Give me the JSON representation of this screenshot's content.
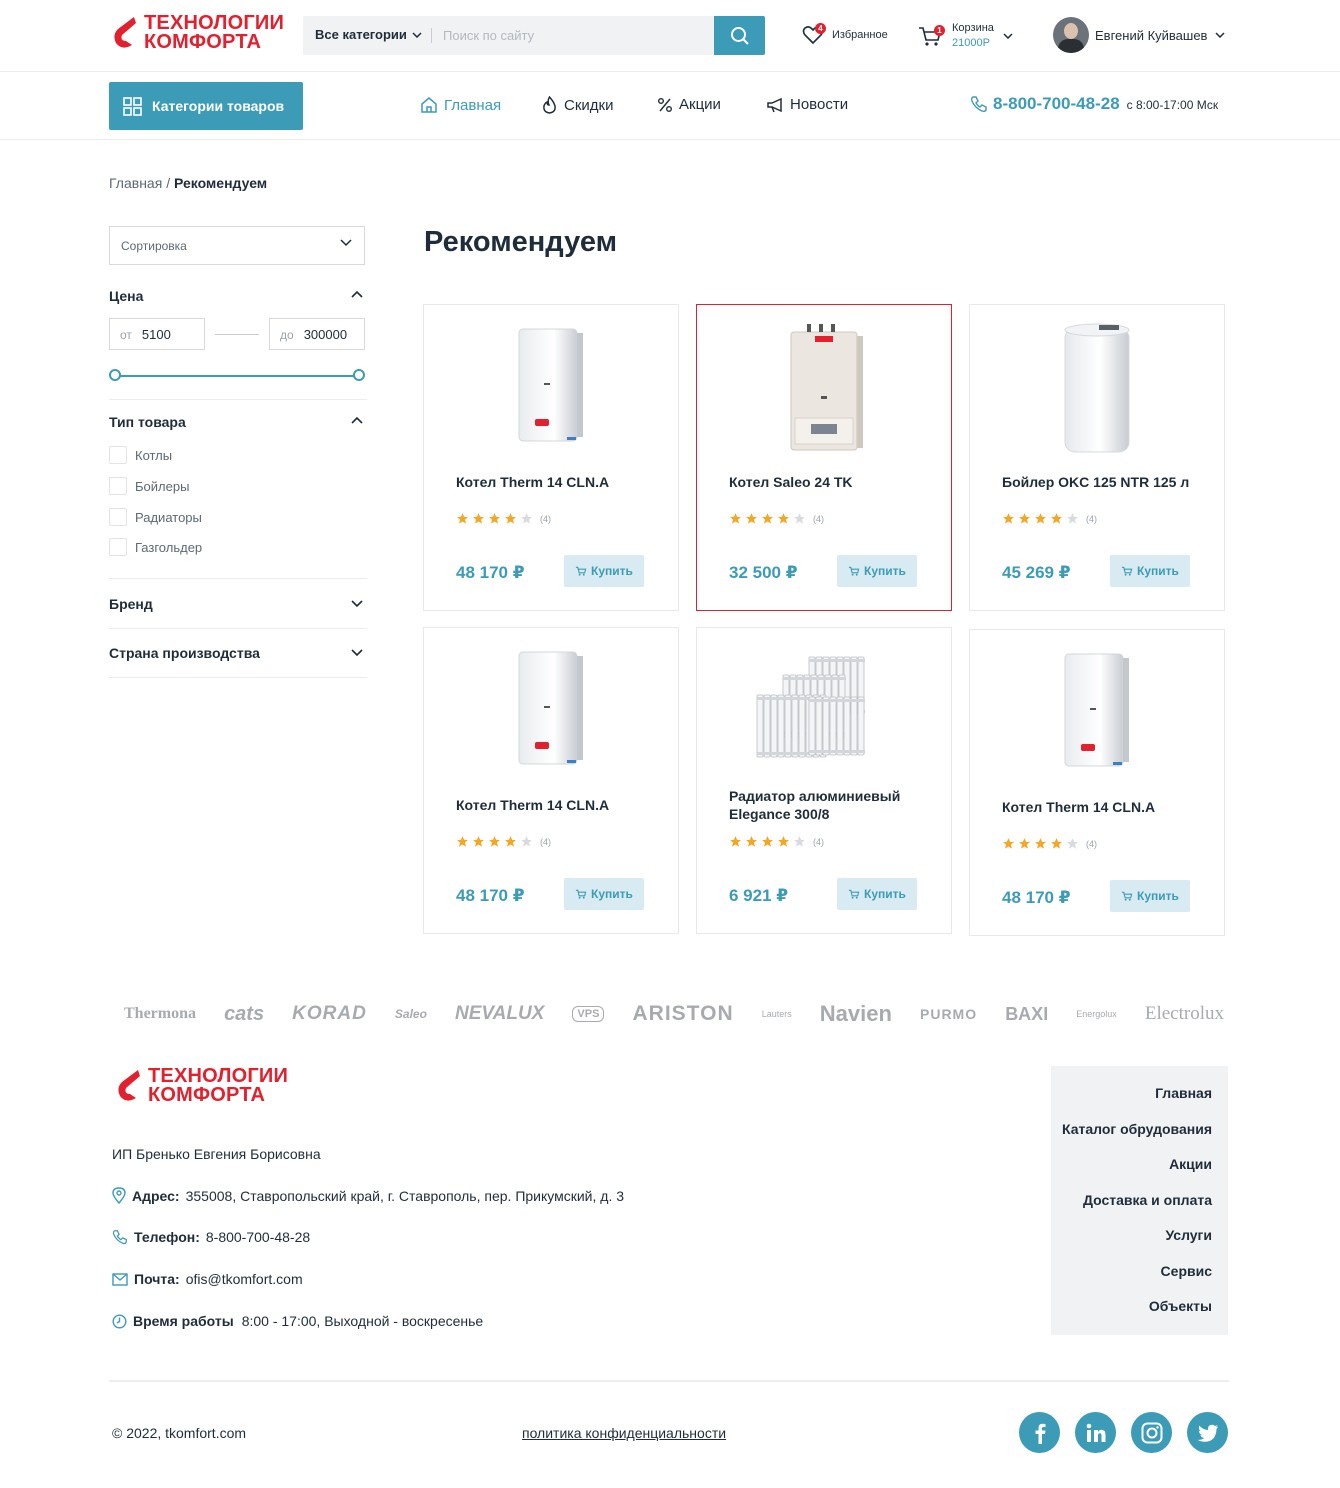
{
  "header": {
    "logo_line1": "ТЕХНОЛОГИИ",
    "logo_line2": "КОМФОРТА",
    "search_category": "Все категории",
    "search_placeholder": "Поиск по сайту",
    "favorites_label": "Избранное",
    "favorites_count": "4",
    "cart_label": "Корзина",
    "cart_total": "21000Р",
    "cart_count": "1",
    "user_name": "Евгений Куйвашев"
  },
  "nav": {
    "categories_button": "Категории товаров",
    "links": [
      {
        "label": "Главная",
        "icon": "home-icon",
        "active": true
      },
      {
        "label": "Скидки",
        "icon": "flame-icon",
        "active": false
      },
      {
        "label": "Акции",
        "icon": "percent-icon",
        "active": false
      },
      {
        "label": "Новости",
        "icon": "megaphone-icon",
        "active": false
      }
    ],
    "phone": "8-800-700-48-28",
    "hours": "с 8:00-17:00 Мск"
  },
  "breadcrumb": {
    "home": "Главная",
    "separator": "/",
    "current": "Рекомендуем"
  },
  "sidebar": {
    "sort_label": "Сортировка",
    "price": {
      "title": "Цена",
      "from_prefix": "от",
      "from_value": "5100",
      "to_prefix": "до",
      "to_value": "300000"
    },
    "type": {
      "title": "Тип товара",
      "options": [
        "Котлы",
        "Бойлеры",
        "Радиаторы",
        "Газгольдер"
      ]
    },
    "brand_title": "Бренд",
    "country_title": "Страна производства"
  },
  "page_title": "Рекомендуем",
  "products": [
    {
      "name": "Котел Therm 14 CLN.A",
      "rating": 4,
      "reviews": "(4)",
      "price": "48 170 ₽",
      "buy": "Купить",
      "image": "boiler-white"
    },
    {
      "name": "Котел Saleo 24 TK",
      "rating": 4,
      "reviews": "(4)",
      "price": "32 500 ₽",
      "buy": "Купить",
      "image": "boiler-beige"
    },
    {
      "name": "Бойлер OKC 125 NTR 125 л",
      "rating": 4,
      "reviews": "(4)",
      "price": "45 269 ₽",
      "buy": "Купить",
      "image": "water-heater"
    },
    {
      "name": "Котел Therm 14 CLN.A",
      "rating": 4,
      "reviews": "(4)",
      "price": "48 170 ₽",
      "buy": "Купить",
      "image": "boiler-white"
    },
    {
      "name": "Радиатор алюминиевый Elegance 300/8",
      "rating": 4,
      "reviews": "(4)",
      "price": "6 921 ₽",
      "buy": "Купить",
      "image": "radiators"
    },
    {
      "name": "Котел Therm 14 CLN.A",
      "rating": 4,
      "reviews": "(4)",
      "price": "48 170 ₽",
      "buy": "Купить",
      "image": "boiler-white"
    }
  ],
  "brands": [
    "Thermona",
    "cats",
    "KORAD",
    "Saleo",
    "NEVALUX",
    "VPS",
    "ARISTON",
    "Lauters",
    "Navien",
    "PURMO",
    "BAXI",
    "Energolux",
    "Electrolux"
  ],
  "footer": {
    "company": "ИП Бренько Евгения Борисовна",
    "address_label": "Адрес:",
    "address": "355008, Ставропольский край, г. Ставрополь, пер. Прикумский, д. 3",
    "phone_label": "Телефон:",
    "phone": "8-800-700-48-28",
    "email_label": "Почта:",
    "email": "ofis@tkomfort.com",
    "hours_label": "Время работы",
    "hours": "8:00 - 17:00, Выходной - воскресенье",
    "menu": [
      "Главная",
      "Каталог обрудования",
      "Акции",
      "Доставка и оплата",
      "Услуги",
      "Сервис",
      "Объекты"
    ],
    "copyright": "© 2022, tkomfort.com",
    "policy": "политика конфиденциальности",
    "social": [
      "facebook-icon",
      "linkedin-icon",
      "instagram-icon",
      "twitter-icon"
    ]
  },
  "colors": {
    "accent": "#3c9bb6",
    "brand_red": "#e3202d",
    "star": "#f5a623",
    "text": "#1f2d3a"
  }
}
